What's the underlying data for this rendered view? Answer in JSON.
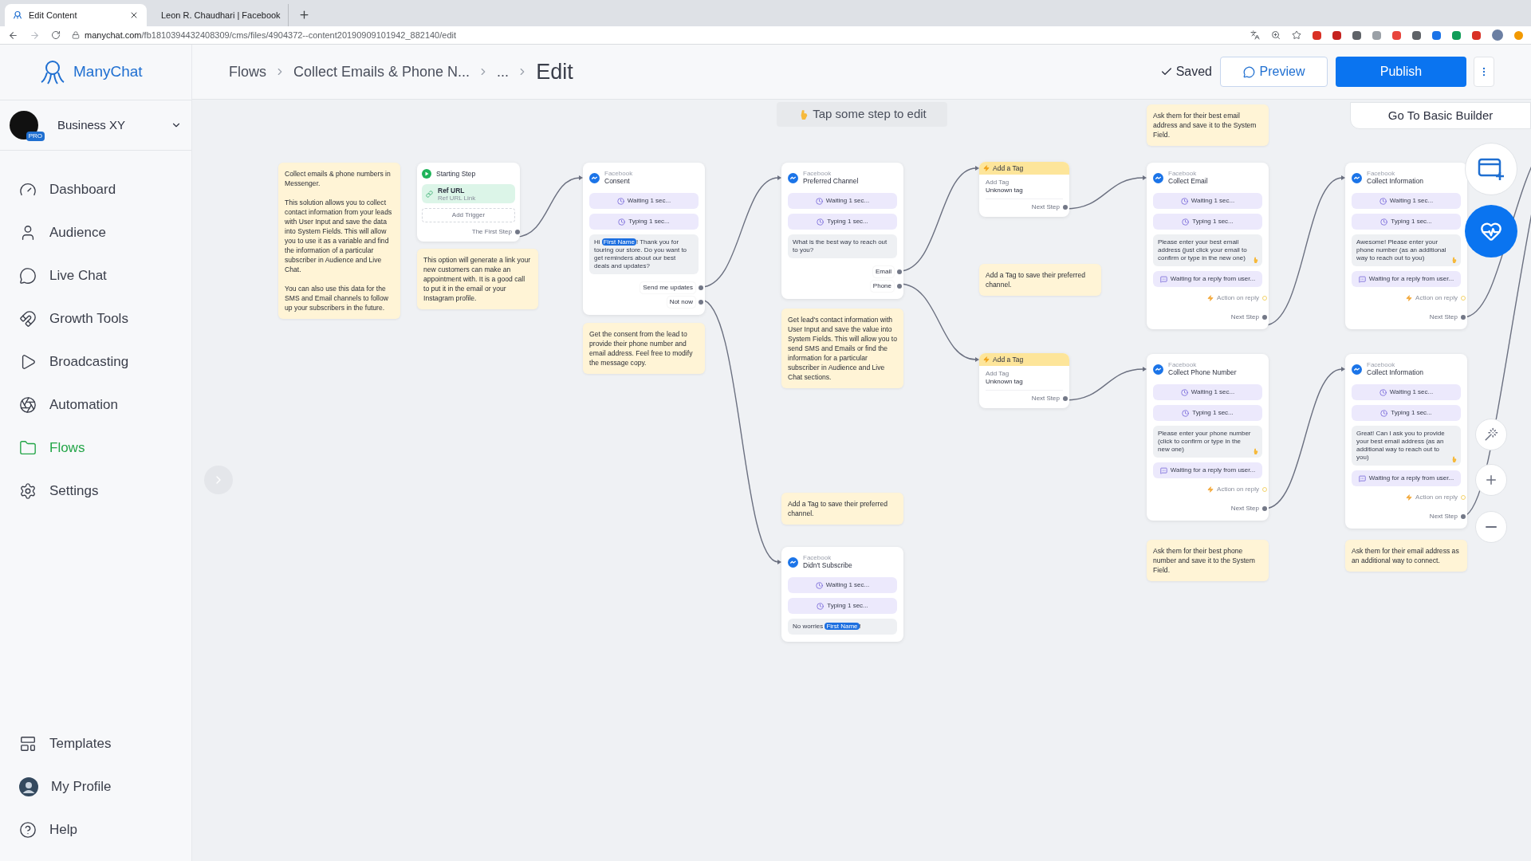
{
  "browser": {
    "tabs": [
      {
        "title": "Edit Content",
        "selected": true
      },
      {
        "title": "Leon R. Chaudhari | Facebook",
        "selected": false
      }
    ],
    "url": {
      "host": "manychat.com",
      "path": "/fb1810394432408309/cms/files/4904372--content20190909101942_882140/edit"
    }
  },
  "sidebar": {
    "brand": "ManyChat",
    "account": {
      "name": "Business XY",
      "badge": "PRO"
    },
    "items": [
      {
        "label": "Dashboard",
        "selected": false
      },
      {
        "label": "Audience",
        "selected": false
      },
      {
        "label": "Live Chat",
        "selected": false
      },
      {
        "label": "Growth Tools",
        "selected": false
      },
      {
        "label": "Broadcasting",
        "selected": false
      },
      {
        "label": "Automation",
        "selected": false
      },
      {
        "label": "Flows",
        "selected": true
      },
      {
        "label": "Settings",
        "selected": false
      }
    ],
    "bottom_items": [
      {
        "label": "Templates"
      },
      {
        "label": "My Profile"
      },
      {
        "label": "Help"
      }
    ]
  },
  "header": {
    "breadcrumbs": [
      "Flows",
      "Collect Emails & Phone N...",
      "..."
    ],
    "page_title": "Edit",
    "status": "Saved",
    "preview": "Preview",
    "publish": "Publish"
  },
  "canvas": {
    "hint": {
      "text": "Tap some step to edit",
      "pointer": true
    },
    "basic_builder": "Go To Basic Builder",
    "nodes": [
      {
        "kind": "note",
        "paragraphs": [
          "Collect emails & phone numbers in Messenger.",
          "This solution allows you to collect contact information from your leads with User Input and save the data into System Fields. This will allow you to use it as a variable and find the information of a particular subscriber in Audience and Live Chat.",
          "You can also use this data for the SMS and Email channels to follow up your subscribers in the future."
        ]
      },
      {
        "kind": "start",
        "title": "Starting Step",
        "trigger": {
          "title": "Ref URL",
          "subtitle": "Ref URL Link"
        },
        "add_trigger": "Add Trigger",
        "next": "The First Step"
      },
      {
        "kind": "note",
        "paragraphs": [
          "This option will generate a link your new customers can make an appointment with. It is a good call to put it in the email or your Instagram profile."
        ]
      },
      {
        "kind": "message",
        "channel": "Facebook",
        "title": "Consent",
        "rows": [
          {
            "kind": "delay",
            "text": "Waiting 1 sec..."
          },
          {
            "kind": "delay",
            "text": "Typing 1 sec..."
          },
          {
            "kind": "text",
            "pointer": false,
            "parts": [
              {
                "text": "Hi ",
                "variable": false
              },
              {
                "text": "First Name",
                "variable": true
              },
              {
                "text": "! Thank you for touring our store. Do you want to get reminders about our best deals and updates?",
                "variable": false
              }
            ]
          }
        ],
        "buttons": [
          "Send me updates",
          "Not now"
        ]
      },
      {
        "kind": "note",
        "paragraphs": [
          "Get the consent from the lead to provide their phone number and email address. Feel free to modify the message copy."
        ]
      },
      {
        "kind": "message",
        "channel": "Facebook",
        "title": "Preferred Channel",
        "rows": [
          {
            "kind": "delay",
            "text": "Waiting 1 sec..."
          },
          {
            "kind": "delay",
            "text": "Typing 1 sec..."
          },
          {
            "kind": "text",
            "pointer": false,
            "parts": [
              {
                "text": "What is the best way to reach out to you?",
                "variable": false
              }
            ]
          }
        ],
        "buttons": [
          "Email",
          "Phone"
        ]
      },
      {
        "kind": "note",
        "paragraphs": [
          "Get lead's contact information with User Input and save the value into System Fields. This will allow you to send SMS and Emails or find the information for a particular subscriber in Audience and Live Chat sections."
        ]
      },
      {
        "kind": "note",
        "paragraphs": [
          "Add a Tag to save their preferred channel."
        ]
      },
      {
        "kind": "message",
        "channel": "Facebook",
        "title": "Didn't Subscribe",
        "rows": [
          {
            "kind": "delay",
            "text": "Waiting 1 sec..."
          },
          {
            "kind": "delay",
            "text": "Typing 1 sec..."
          },
          {
            "kind": "text",
            "pointer": false,
            "parts": [
              {
                "text": "No worries ",
                "variable": false
              },
              {
                "text": "First Name",
                "variable": true
              },
              {
                "text": "!",
                "variable": false
              }
            ]
          }
        ]
      },
      {
        "kind": "tag",
        "title": "Add a Tag",
        "label": "Add Tag",
        "value": "Unknown tag",
        "next": "Next Step"
      },
      {
        "kind": "note",
        "paragraphs": [
          "Add a Tag to save their preferred channel."
        ]
      },
      {
        "kind": "tag",
        "title": "Add a Tag",
        "label": "Add Tag",
        "value": "Unknown tag",
        "next": "Next Step"
      },
      {
        "kind": "note",
        "paragraphs": [
          "Ask them for their best email address and save it to the System Field."
        ]
      },
      {
        "kind": "message",
        "channel": "Facebook",
        "title": "Collect Email",
        "rows": [
          {
            "kind": "delay",
            "text": "Waiting 1 sec..."
          },
          {
            "kind": "delay",
            "text": "Typing 1 sec..."
          },
          {
            "kind": "text",
            "pointer": true,
            "parts": [
              {
                "text": "Please enter your best email address (just click your email to confirm or type in the new one)",
                "variable": false
              }
            ]
          },
          {
            "kind": "input",
            "text": "Waiting for a reply from user..."
          }
        ],
        "action": "Action on reply",
        "next": "Next Step"
      },
      {
        "kind": "message",
        "channel": "Facebook",
        "title": "Collect Phone Number",
        "rows": [
          {
            "kind": "delay",
            "text": "Waiting 1 sec..."
          },
          {
            "kind": "delay",
            "text": "Typing 1 sec..."
          },
          {
            "kind": "text",
            "pointer": true,
            "parts": [
              {
                "text": "Please enter your phone number (click to confirm or type in the new one)",
                "variable": false
              }
            ]
          },
          {
            "kind": "input",
            "text": "Waiting for a reply from user..."
          }
        ],
        "action": "Action on reply",
        "next": "Next Step"
      },
      {
        "kind": "note",
        "paragraphs": [
          "Ask them for their best phone number and save it to the System Field."
        ]
      },
      {
        "kind": "message",
        "channel": "Facebook",
        "title": "Collect Information",
        "rows": [
          {
            "kind": "delay",
            "text": "Waiting 1 sec..."
          },
          {
            "kind": "delay",
            "text": "Typing 1 sec..."
          },
          {
            "kind": "text",
            "pointer": true,
            "parts": [
              {
                "text": "Awesome! Please enter your phone number (as an additional way to reach out to you)",
                "variable": false
              }
            ]
          },
          {
            "kind": "input",
            "text": "Waiting for a reply from user..."
          }
        ],
        "action": "Action on reply",
        "next": "Next Step"
      },
      {
        "kind": "message",
        "channel": "Facebook",
        "title": "Collect Information",
        "rows": [
          {
            "kind": "delay",
            "text": "Waiting 1 sec..."
          },
          {
            "kind": "delay",
            "text": "Typing 1 sec..."
          },
          {
            "kind": "text",
            "pointer": true,
            "parts": [
              {
                "text": "Great! Can I ask you to provide your best email address (as an additional way to reach out to you)",
                "variable": false
              }
            ]
          },
          {
            "kind": "input",
            "text": "Waiting for a reply from user..."
          }
        ],
        "action": "Action on reply",
        "next": "Next Step"
      },
      {
        "kind": "note",
        "paragraphs": [
          "Ask them for their email address as an additional way to connect."
        ]
      }
    ]
  }
}
